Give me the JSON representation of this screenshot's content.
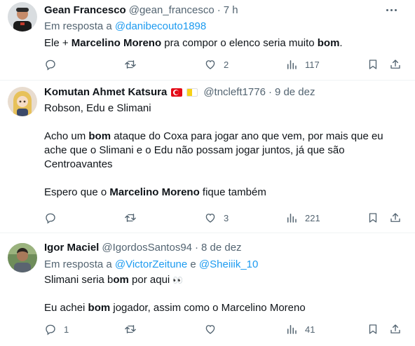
{
  "tweets": [
    {
      "name": "Gean Francesco",
      "handle": "@gean_francesco",
      "dot": "·",
      "time": "7 h",
      "reply_prefix": "Em resposta a",
      "reply_to": "@danibecouto1898",
      "text": {
        "a": "Ele + ",
        "b": "Marcelino Moreno",
        "c": " pra compor o elenco seria muito ",
        "d": "bom",
        "e": "."
      },
      "counts": {
        "replies": "",
        "retweets": "",
        "likes": "2",
        "views": "117"
      }
    },
    {
      "name": "Komutan Ahmet Katsura",
      "handle": "@tncleft1776",
      "dot": "·",
      "time": "9 de dez",
      "flags": [
        "turkey-flag",
        "vatican-flag"
      ],
      "text": {
        "line1": "Robson, Edu e Slimani",
        "p2a": "Acho um ",
        "p2b": "bom",
        "p2c": " ataque do Coxa para jogar ano que vem, por mais que eu",
        "p2d": "ache que o Slimani e o Edu não possam jogar juntos, já que são",
        "p2e": "Centroavantes",
        "p3a": "Espero que o ",
        "p3b": "Marcelino Moreno",
        "p3c": " fique também"
      },
      "counts": {
        "replies": "",
        "retweets": "",
        "likes": "3",
        "views": "221"
      }
    },
    {
      "name": "Igor Maciel",
      "handle": "@IgordosSantos94",
      "dot": "·",
      "time": "8 de dez",
      "reply_prefix": "Em resposta a",
      "reply_to_1": "@VictorZeitune",
      "reply_joiner": "e",
      "reply_to_2": "@Sheiiik_10",
      "text": {
        "l1a": "Slimani seria b",
        "l1b": "om",
        "l1c": " por aqui ",
        "l1emoji": "👀",
        "l2a": "Eu achei ",
        "l2b": "bom",
        "l2c": " jogador, assim como o Marcelino Moreno"
      },
      "counts": {
        "replies": "1",
        "retweets": "",
        "likes": "",
        "views": "41"
      }
    }
  ],
  "icons": [
    "reply-icon",
    "retweet-icon",
    "like-icon",
    "views-icon",
    "bookmark-icon",
    "share-icon",
    "more-icon"
  ],
  "colors": {
    "text": "#0f1419",
    "secondary": "#536471",
    "link": "#1d9bf0",
    "divider": "#eff3f4"
  }
}
